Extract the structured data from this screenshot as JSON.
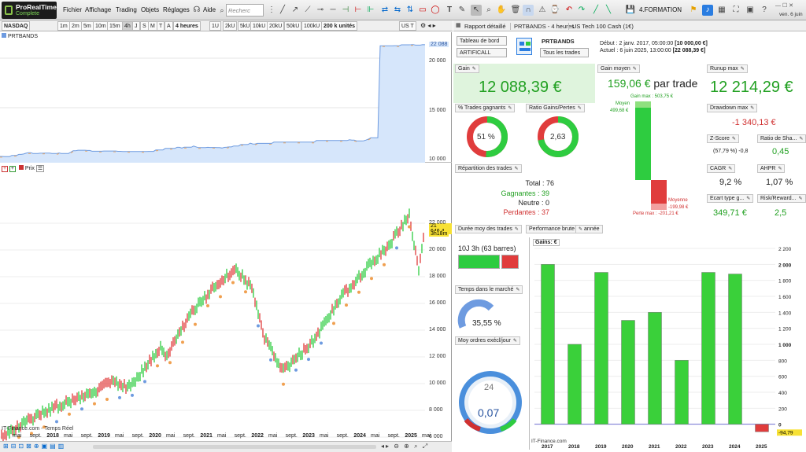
{
  "app": {
    "name": "ProRealTime",
    "edition": "Complete",
    "clock": "ven. 6 juin"
  },
  "menu": [
    "Fichier",
    "Affichage",
    "Trading",
    "Objets",
    "Réglages",
    "Aide"
  ],
  "search": {
    "placeholder": "Recherc"
  },
  "workspace": {
    "label": "4.FORMATION"
  },
  "chart": {
    "instrument": "NASDAQ",
    "timeframes": [
      "1m",
      "2m",
      "5m",
      "10m",
      "15m",
      "4h",
      "J",
      "S",
      "M",
      "T",
      "A"
    ],
    "active_timeframe": "4h",
    "period_select": "4 heures",
    "ticks": [
      "1U",
      "2kU",
      "5kU",
      "10kU",
      "20kU",
      "50kU",
      "100kU"
    ],
    "units": "200 k unités",
    "us_tab": "US T",
    "equity_title": "PRTBANDS",
    "equity_last": "22 088",
    "equity_yticks": [
      "20 000",
      "15 000",
      "10 000"
    ],
    "price_label": "Prix",
    "price_last": "21 646,4",
    "price_timer": "3h18m",
    "price_yticks": [
      "22 000",
      "20 000",
      "18 000",
      "16 000",
      "14 000",
      "12 000",
      "10 000",
      "8 000",
      "6 000"
    ],
    "xlabels": [
      "mai",
      "sept.",
      "2018",
      "mai",
      "sept.",
      "2019",
      "mai",
      "sept.",
      "2020",
      "mai",
      "sept.",
      "2021",
      "mai",
      "sept.",
      "2022",
      "mai",
      "sept.",
      "2023",
      "mai",
      "sept.",
      "2024",
      "mai",
      "sept.",
      "2025",
      "mai"
    ],
    "source": "IT-Finance.com - Temps Réel"
  },
  "report": {
    "title": "Rapport détaillé",
    "system": "PRTBANDS - 4 heures",
    "instrument": "US Tech 100 Cash (1€)",
    "dashboard_select": "Tableau de bord",
    "filter_select": "ARTIFICALL",
    "name": "PRTBANDS",
    "trades_select": "Tous les trades",
    "debut_label": "Début :",
    "debut_value": "2 janv. 2017, 05:00:00",
    "debut_capital": "[10 000,00 €]",
    "actuel_label": "Actuel :",
    "actuel_value": "6 juin 2025, 13:00:00",
    "actuel_capital": "[22 088,39 €]",
    "gain_label": "Gain",
    "gain_value": "12 088,39 €",
    "gain_moyen_label": "Gain moyen",
    "gain_moyen_value": "159,06 €",
    "gain_moyen_suffix": "par trade",
    "gain_max": "Gain max : 503,75 €",
    "moyen_label": "Moyen",
    "moyen_value": "499,68 €",
    "moyenne_label": "Moyenne",
    "moyenne_value": "-199,98 €",
    "perte_max": "Perte max : -201,21 €",
    "runup_label": "Runup max",
    "runup_value": "12 214,29 €",
    "drawdown_label": "Drawdown max",
    "drawdown_value": "-1 340,13 €",
    "pct_trades_label": "% Trades gagnants",
    "pct_trades_value": "51 %",
    "ratio_label": "Ratio Gains/Pertes",
    "ratio_value": "2,63",
    "zscore_label": "Z-Score",
    "zscore_value": "(57,79 %) -0,8",
    "sharpe_label": "Ratio de Sha...",
    "sharpe_value": "0,45",
    "cagr_label": "CAGR",
    "cagr_value": "9,2 %",
    "ahpr_label": "AHPR",
    "ahpr_value": "1,07 %",
    "ecart_label": "Ecart type g...",
    "ecart_value": "349,71 €",
    "rr_label": "Risk/Reward...",
    "rr_value": "2,5",
    "repartition_label": "Répartition des trades",
    "total": "Total : 76",
    "gagnantes": "Gagnantes : 39",
    "neutre": "Neutre : 0",
    "perdantes": "Perdantes : 37",
    "duree_label": "Durée moy des trades",
    "duree_value": "10J 3h (63 barres)",
    "perf_label": "Performance brute",
    "perf_select": "année",
    "temps_label": "Temps dans le marché",
    "temps_value": "35,55 %",
    "ordres_label": "Moy ordres exécl/jour",
    "ordres_value": "0,07",
    "gauge_top": "24",
    "gains_title": "Gains: €",
    "source": "IT-Finance.com"
  },
  "colors": {
    "green": "#2ecc40",
    "red": "#e03c3c",
    "blue_fill": "#d6e6fb",
    "blue_line": "#6e9be0"
  },
  "chart_data": {
    "type": "bar",
    "categories": [
      "2017",
      "2018",
      "2019",
      "2020",
      "2021",
      "2022",
      "2023",
      "2024",
      "2025"
    ],
    "values": [
      2000,
      1000,
      1900,
      1300,
      1400,
      800,
      1900,
      1880,
      -94.79
    ],
    "title": "Gains: €",
    "ylim": [
      -200,
      2200
    ],
    "yticks": [
      "2 200",
      "2 000",
      "1 800",
      "1 600",
      "1 400",
      "1 200",
      "1 000",
      "800",
      "600",
      "400",
      "200",
      "0",
      "-94,79"
    ]
  }
}
